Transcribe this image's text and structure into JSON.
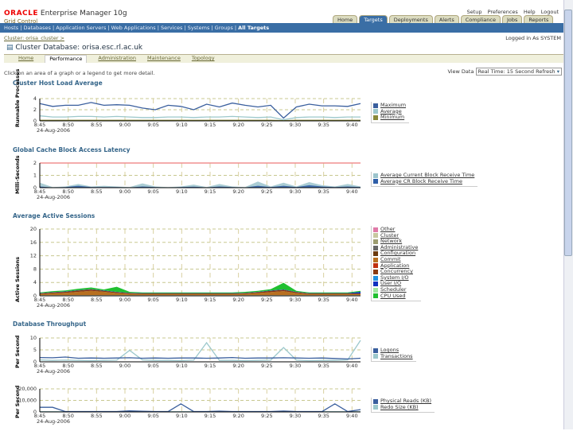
{
  "header": {
    "oracle": "ORACLE",
    "product": "Enterprise Manager 10g",
    "grid": "Grid Control",
    "links": "Setup Preferences Help Logout",
    "tabs": [
      "Home",
      "Targets",
      "Deployments",
      "Alerts",
      "Compliance",
      "Jobs",
      "Reports"
    ],
    "nav": [
      "Hosts",
      "Databases",
      "Application Servers",
      "Web Applications",
      "Services",
      "Systems",
      "Groups"
    ],
    "nav_active": "All Targets"
  },
  "breadcrumb": "Cluster: orisa_cluster >",
  "logged_in": "Logged in As SYSTEM",
  "title": "Cluster Database: orisa.esc.rl.ac.uk",
  "subtabs": [
    "Home",
    "Performance",
    "Administration",
    "Maintenance",
    "Topology"
  ],
  "instruction": "Click on an area of a graph or a legend to get more detail.",
  "view_data_label": "View Data",
  "view_data_value": "Real Time: 15 Second Refresh",
  "chart_data": [
    {
      "type": "line",
      "title": "Cluster Host Load Average",
      "ylabel": "Runnable Processes",
      "ylim": [
        0,
        4
      ],
      "yticks": [
        "0",
        "2",
        "4"
      ],
      "x": [
        "8:45",
        "8:50",
        "8:55",
        "9:00",
        "9:05",
        "9:10",
        "9:15",
        "9:20",
        "9:25",
        "9:30",
        "9:35",
        "9:40"
      ],
      "date": "24-Aug-2006",
      "series": [
        {
          "name": "Maximum",
          "color": "#3a5f9e",
          "values": [
            3.1,
            2.6,
            2.8,
            2.8,
            3.3,
            2.8,
            2.9,
            2.8,
            2.3,
            2.0,
            2.8,
            2.6,
            2.0,
            3.0,
            2.5,
            3.2,
            2.8,
            2.5,
            2.8,
            0.5,
            2.5,
            3.0,
            2.7,
            2.7,
            2.6,
            3.1
          ]
        },
        {
          "name": "Average",
          "color": "#9cc8cc",
          "values": [
            0.9,
            0.7,
            0.7,
            0.8,
            0.8,
            0.7,
            0.8,
            0.7,
            0.6,
            0.6,
            0.7,
            0.7,
            0.6,
            0.7,
            0.7,
            0.8,
            0.7,
            0.6,
            0.7,
            0.2,
            0.6,
            0.7,
            0.7,
            0.6,
            0.7,
            0.7
          ]
        },
        {
          "name": "Minimum",
          "color": "#8a8a3a",
          "values": [
            0.1,
            0.1,
            0.1,
            0.1,
            0.1,
            0.1,
            0.1,
            0.1,
            0.1,
            0.1,
            0.1,
            0.1,
            0.1,
            0.1,
            0.1,
            0.1,
            0.1,
            0.1,
            0.1,
            0.05,
            0.1,
            0.1,
            0.1,
            0.1,
            0.1,
            0.1
          ]
        }
      ]
    },
    {
      "type": "area",
      "title": "Global Cache Block Access Latency",
      "ylabel": "Milli-Seconds",
      "ylim": [
        0,
        2
      ],
      "yticks": [
        "0",
        "1",
        "2"
      ],
      "threshold": 2,
      "x": [
        "8:45",
        "8:50",
        "8:55",
        "9:00",
        "9:05",
        "9:10",
        "9:15",
        "9:20",
        "9:25",
        "9:30",
        "9:35",
        "9:40"
      ],
      "date": "24-Aug-2006",
      "series": [
        {
          "name": "Average Current Block Receive Time",
          "color": "#9cc4cc",
          "values": [
            0.4,
            0.05,
            0.1,
            0.3,
            0.1,
            0.15,
            0.1,
            0.05,
            0.35,
            0.1,
            0.05,
            0.1,
            0.25,
            0.05,
            0.3,
            0.1,
            0.05,
            0.5,
            0.1,
            0.4,
            0.1,
            0.45,
            0.2,
            0.1,
            0.3,
            0.1
          ]
        },
        {
          "name": "Average CR Block Receive Time",
          "color": "#2f5ea8",
          "values": [
            0.1,
            0.02,
            0.05,
            0.15,
            0.05,
            0.05,
            0.05,
            0.02,
            0.1,
            0.05,
            0.02,
            0.05,
            0.08,
            0.02,
            0.1,
            0.05,
            0.02,
            0.15,
            0.05,
            0.15,
            0.05,
            0.2,
            0.1,
            0.05,
            0.1,
            0.05
          ]
        }
      ]
    },
    {
      "type": "area",
      "stacked": true,
      "title": "Average Active Sessions",
      "ylabel": "Active Sessions",
      "ylim": [
        0,
        20
      ],
      "yticks": [
        "0",
        "4",
        "8",
        "12",
        "16",
        "20"
      ],
      "x": [
        "8:45",
        "8:50",
        "8:55",
        "9:00",
        "9:05",
        "9:10",
        "9:15",
        "9:20",
        "9:25",
        "9:30",
        "9:35",
        "9:40"
      ],
      "date": "24-Aug-2006",
      "series": [
        {
          "name": "Other",
          "color": "#e07aa8",
          "values": [
            0,
            0,
            0,
            0,
            0,
            0,
            0,
            0,
            0,
            0,
            0,
            0,
            0,
            0,
            0,
            0,
            0,
            0,
            0,
            0,
            0,
            0,
            0,
            0,
            0,
            0
          ]
        },
        {
          "name": "Cluster",
          "color": "#c8c8a0",
          "values": [
            0.2,
            0.2,
            0.2,
            0.2,
            0.2,
            0.2,
            0.2,
            0.2,
            0.2,
            0.2,
            0.2,
            0.2,
            0.2,
            0.2,
            0.2,
            0.2,
            0.2,
            0.2,
            0.2,
            0.2,
            0.2,
            0.2,
            0.2,
            0.2,
            0.2,
            0.2
          ]
        },
        {
          "name": "Network",
          "color": "#9c9c70",
          "values": [
            0,
            0,
            0,
            0,
            0,
            0,
            0,
            0,
            0,
            0,
            0,
            0,
            0,
            0,
            0,
            0,
            0,
            0,
            0,
            0,
            0,
            0,
            0,
            0,
            0,
            0
          ]
        },
        {
          "name": "Administrative",
          "color": "#666666",
          "values": [
            0,
            0,
            0,
            0,
            0,
            0,
            0,
            0,
            0,
            0,
            0,
            0,
            0,
            0,
            0,
            0,
            0,
            0,
            0,
            0,
            0,
            0,
            0,
            0,
            0,
            0
          ]
        },
        {
          "name": "Configuration",
          "color": "#6b3a10",
          "values": [
            0,
            0,
            0,
            0,
            0,
            0,
            0,
            0,
            0,
            0,
            0,
            0,
            0,
            0,
            0,
            0,
            0,
            0,
            0,
            0,
            0,
            0,
            0,
            0,
            0,
            0
          ]
        },
        {
          "name": "Commit",
          "color": "#b87020",
          "values": [
            0.3,
            0.5,
            0.7,
            1.0,
            1.3,
            1.0,
            0.6,
            0.4,
            0.3,
            0.3,
            0.3,
            0.3,
            0.3,
            0.3,
            0.3,
            0.3,
            0.4,
            0.6,
            0.9,
            1.2,
            0.6,
            0.3,
            0.3,
            0.3,
            0.3,
            0.3
          ]
        },
        {
          "name": "Application",
          "color": "#c03010",
          "values": [
            0,
            0,
            0,
            0,
            0,
            0,
            0,
            0,
            0,
            0,
            0,
            0,
            0,
            0,
            0,
            0,
            0,
            0,
            0,
            0,
            0,
            0,
            0,
            0,
            0,
            0
          ]
        },
        {
          "name": "Concurrency",
          "color": "#8a3a10",
          "values": [
            0.2,
            0.3,
            0.3,
            0.4,
            0.4,
            0.3,
            0.3,
            0.2,
            0.2,
            0.2,
            0.2,
            0.2,
            0.2,
            0.2,
            0.2,
            0.2,
            0.2,
            0.3,
            0.4,
            0.4,
            0.3,
            0.2,
            0.2,
            0.2,
            0.2,
            0.2
          ]
        },
        {
          "name": "System I/O",
          "color": "#2090e0",
          "values": [
            0,
            0,
            0,
            0,
            0,
            0,
            0,
            0,
            0,
            0,
            0,
            0,
            0,
            0,
            0,
            0,
            0,
            0,
            0,
            0,
            0,
            0,
            0,
            0,
            0,
            0
          ]
        },
        {
          "name": "User I/O",
          "color": "#1030c0",
          "values": [
            0.1,
            0.1,
            0.1,
            0.1,
            0.1,
            0.1,
            0.1,
            0.1,
            0.1,
            0.1,
            0.1,
            0.1,
            0.1,
            0.1,
            0.1,
            0.1,
            0.1,
            0.1,
            0.1,
            0.1,
            0.1,
            0.1,
            0.1,
            0.1,
            0.1,
            0.5
          ]
        },
        {
          "name": "Scheduler",
          "color": "#a0e8a0",
          "values": [
            0,
            0,
            0,
            0,
            0,
            0,
            0,
            0,
            0,
            0,
            0,
            0,
            0,
            0,
            0,
            0,
            0,
            0,
            0,
            0,
            0,
            0,
            0,
            0,
            0,
            0
          ]
        },
        {
          "name": "CPU Used",
          "color": "#20c030",
          "values": [
            0.2,
            0.3,
            0.3,
            0.4,
            0.5,
            0.3,
            1.5,
            0.3,
            0.2,
            0.2,
            0.2,
            0.2,
            0.2,
            0.2,
            0.2,
            0.2,
            0.3,
            0.3,
            0.4,
            2.0,
            0.3,
            0.2,
            0.2,
            0.2,
            0.2,
            0.3
          ]
        }
      ]
    },
    {
      "type": "line",
      "title": "Database Throughput",
      "ylabel": "Per Second",
      "ylim": [
        0,
        10
      ],
      "yticks": [
        "0",
        "5",
        "10"
      ],
      "x": [
        "8:45",
        "8:50",
        "8:55",
        "9:00",
        "9:05",
        "9:10",
        "9:15",
        "9:20",
        "9:25",
        "9:30",
        "9:35",
        "9:40"
      ],
      "date": "24-Aug-2006",
      "series": [
        {
          "name": "Logons",
          "color": "#3a5f9e",
          "values": [
            1.8,
            1.7,
            2.0,
            1.5,
            1.6,
            1.5,
            1.6,
            1.7,
            1.5,
            1.6,
            1.5,
            1.6,
            1.6,
            1.5,
            1.6,
            1.8,
            1.5,
            1.6,
            1.6,
            1.7,
            1.6,
            1.5,
            1.6,
            1.4,
            1.2,
            1.5
          ]
        },
        {
          "name": "Transactions",
          "color": "#9cc8cc",
          "values": [
            0.8,
            0.6,
            0.7,
            0.6,
            0.5,
            0.6,
            0.7,
            4.8,
            0.8,
            0.6,
            0.6,
            0.5,
            0.7,
            8.0,
            0.6,
            0.6,
            0.5,
            0.6,
            0.7,
            6.0,
            0.7,
            0.5,
            0.6,
            0.6,
            0.8,
            9.0
          ]
        }
      ]
    },
    {
      "type": "line",
      "title": "",
      "ylabel": "Per Second",
      "ylim": [
        0,
        20000
      ],
      "yticks": [
        "0",
        "10,000",
        "20,000"
      ],
      "x": [
        "8:45",
        "8:50",
        "8:55",
        "9:00",
        "9:05",
        "9:10",
        "9:15",
        "9:20",
        "9:25",
        "9:30",
        "9:35",
        "9:40"
      ],
      "date": "24-Aug-2006",
      "series": [
        {
          "name": "Physical Reads (KB)",
          "color": "#3a5f9e",
          "values": [
            4000,
            4000,
            300,
            300,
            300,
            300,
            300,
            900,
            600,
            300,
            300,
            7000,
            300,
            300,
            700,
            300,
            300,
            300,
            300,
            800,
            300,
            300,
            300,
            7000,
            300,
            2000
          ]
        },
        {
          "name": "Redo Size (KB)",
          "color": "#9cc8cc",
          "values": [
            200,
            200,
            200,
            200,
            200,
            200,
            200,
            200,
            200,
            200,
            200,
            200,
            200,
            200,
            200,
            200,
            200,
            200,
            200,
            200,
            200,
            200,
            200,
            200,
            200,
            200
          ]
        }
      ]
    }
  ]
}
